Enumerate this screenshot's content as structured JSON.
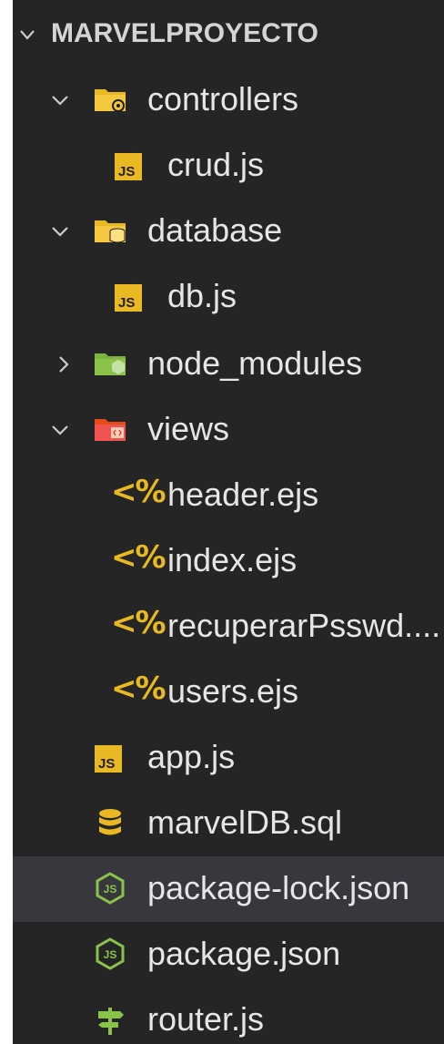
{
  "explorer": {
    "section_title": "MARVELPROYECTO",
    "items": [
      {
        "label": "controllers",
        "kind": "folder",
        "state": "expanded",
        "icon": "folder-controllers-icon",
        "color": "#e8b923"
      },
      {
        "label": "crud.js",
        "kind": "file",
        "icon": "js-file-icon",
        "badge": "JS"
      },
      {
        "label": "database",
        "kind": "folder",
        "state": "expanded",
        "icon": "folder-database-icon",
        "color": "#e8b923"
      },
      {
        "label": "db.js",
        "kind": "file",
        "icon": "js-file-icon",
        "badge": "JS"
      },
      {
        "label": "node_modules",
        "kind": "folder",
        "state": "collapsed",
        "icon": "folder-node-icon",
        "color": "#7cb342"
      },
      {
        "label": "views",
        "kind": "folder",
        "state": "expanded",
        "icon": "folder-views-icon",
        "color": "#ef5350"
      },
      {
        "label": "header.ejs",
        "kind": "file",
        "icon": "ejs-file-icon",
        "glyph": "<%"
      },
      {
        "label": "index.ejs",
        "kind": "file",
        "icon": "ejs-file-icon",
        "glyph": "<%"
      },
      {
        "label": "recuperarPsswd....",
        "kind": "file",
        "icon": "ejs-file-icon",
        "glyph": "<%"
      },
      {
        "label": "users.ejs",
        "kind": "file",
        "icon": "ejs-file-icon",
        "glyph": "<%"
      },
      {
        "label": "app.js",
        "kind": "file",
        "icon": "js-file-icon",
        "badge": "JS"
      },
      {
        "label": "marvelDB.sql",
        "kind": "file",
        "icon": "database-icon"
      },
      {
        "label": "package-lock.json",
        "kind": "file",
        "icon": "nodejs-icon",
        "selected": true
      },
      {
        "label": "package.json",
        "kind": "file",
        "icon": "nodejs-icon"
      },
      {
        "label": "router.js",
        "kind": "file",
        "icon": "router-icon"
      }
    ]
  },
  "colors": {
    "background": "#252526",
    "selected_row": "#37373d",
    "js_yellow": "#e8b923",
    "node_green": "#8bc34a",
    "folder_green": "#7cb342",
    "views_red": "#ef5350",
    "text": "#e6e6e6"
  }
}
